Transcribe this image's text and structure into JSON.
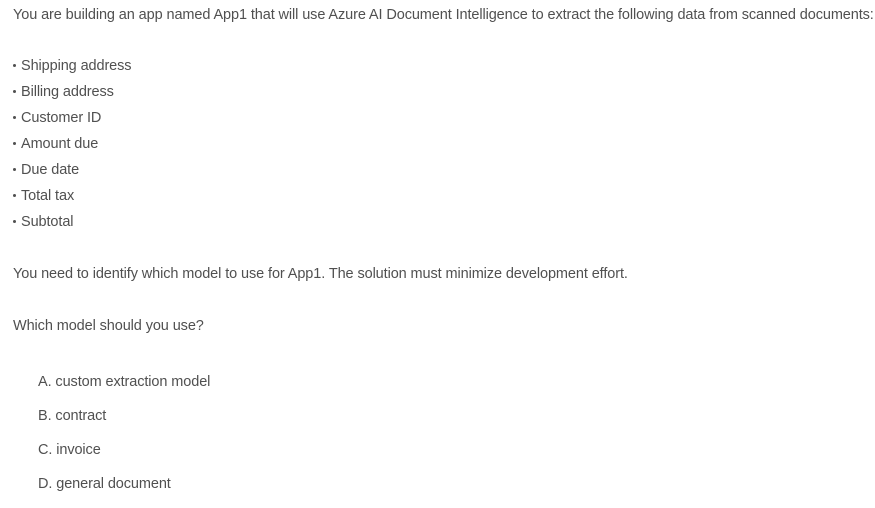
{
  "question": {
    "intro": "You are building an app named App1 that will use Azure AI Document Intelligence to extract the following data from scanned documents:",
    "bullets": [
      "Shipping address",
      "Billing address",
      "Customer ID",
      "Amount due",
      "Due date",
      "Total tax",
      "Subtotal"
    ],
    "requirement": "You need to identify which model to use for App1. The solution must minimize development effort.",
    "prompt": "Which model should you use?",
    "options": [
      "A. custom extraction model",
      "B. contract",
      "C. invoice",
      "D. general document"
    ]
  }
}
